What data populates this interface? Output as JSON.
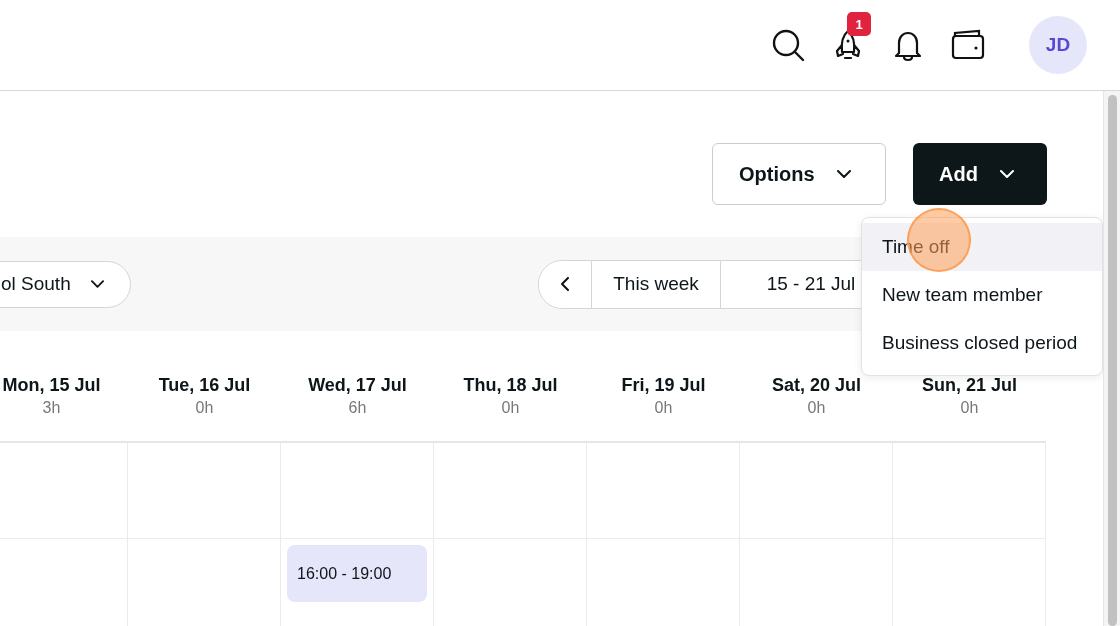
{
  "header": {
    "notifications_badge": "1",
    "avatar_initials": "JD"
  },
  "actions": {
    "options_label": "Options",
    "add_label": "Add"
  },
  "toolbar": {
    "location": "ol South",
    "this_week": "This week",
    "range": "15 - 21 Jul"
  },
  "days": [
    {
      "label": "Mon, 15 Jul",
      "hours": "3h"
    },
    {
      "label": "Tue, 16 Jul",
      "hours": "0h"
    },
    {
      "label": "Wed, 17 Jul",
      "hours": "6h",
      "shifts": [
        {
          "time": "16:00 - 19:00"
        }
      ]
    },
    {
      "label": "Thu, 18 Jul",
      "hours": "0h"
    },
    {
      "label": "Fri, 19 Jul",
      "hours": "0h"
    },
    {
      "label": "Sat, 20 Jul",
      "hours": "0h"
    },
    {
      "label": "Sun, 21 Jul",
      "hours": "0h"
    }
  ],
  "add_menu": [
    {
      "label": "Time off",
      "selected": true
    },
    {
      "label": "New team member",
      "selected": false
    },
    {
      "label": "Business closed period",
      "selected": false
    }
  ]
}
